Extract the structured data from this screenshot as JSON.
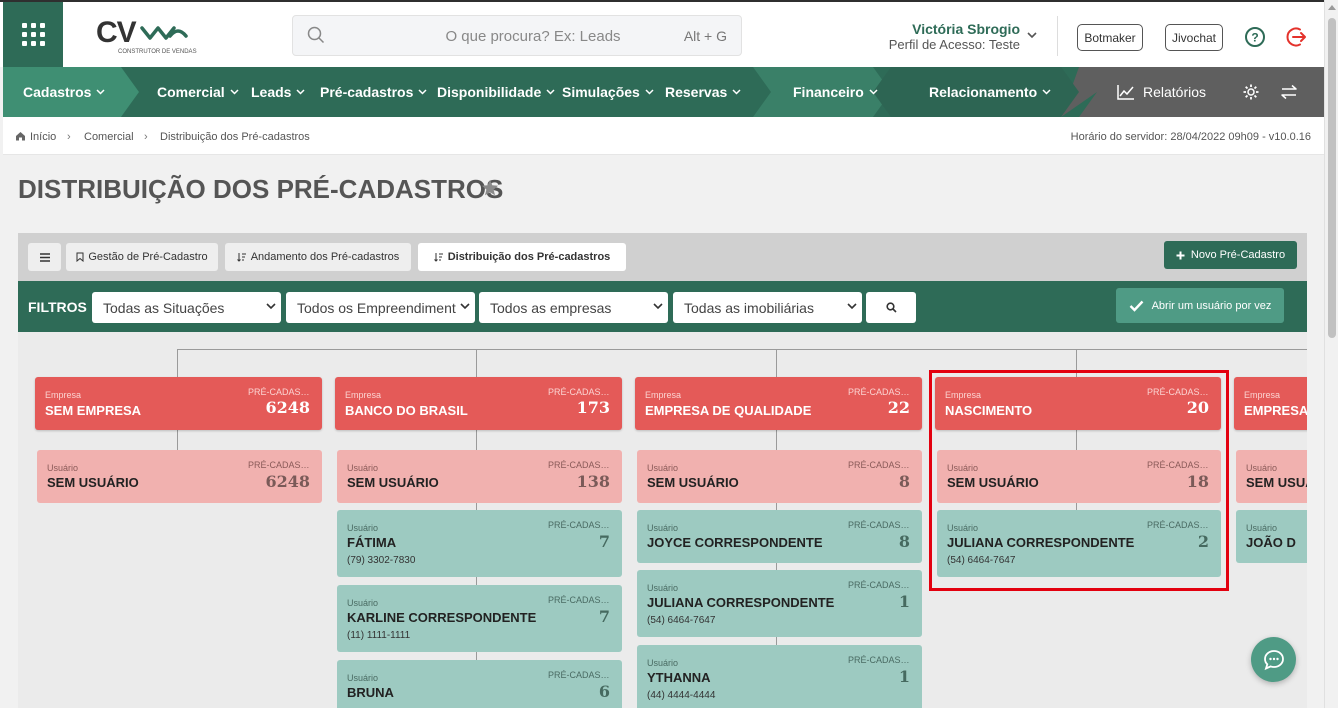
{
  "header": {
    "logo_text": "CV",
    "logo_subtitle": "CONSTRUTOR DE VENDAS",
    "search": {
      "placeholder": "O que procura? Ex: Leads",
      "shortcut": "Alt + G"
    },
    "user": {
      "name": "Victória Sbrogio",
      "profile": "Perfil de Acesso: Teste"
    },
    "buttons": [
      "Botmaker",
      "Jivochat"
    ]
  },
  "nav": {
    "items": [
      "Cadastros",
      "Comercial",
      "Leads",
      "Pré-cadastros",
      "Disponibilidade",
      "Simulações",
      "Reservas",
      "Financeiro",
      "Relacionamento"
    ],
    "reports": "Relatórios"
  },
  "breadcrumb": {
    "items": [
      "Início",
      "Comercial",
      "Distribuição dos Pré-cadastros"
    ],
    "server_time": "Horário do servidor: 28/04/2022 09h09 - v10.0.16"
  },
  "page": {
    "title": "DISTRIBUIÇÃO DOS PRÉ-CADASTROS"
  },
  "tabs": {
    "items": [
      "Gestão de Pré-Cadastro",
      "Andamento dos Pré-cadastros",
      "Distribuição dos Pré-cadastros"
    ],
    "new_button": "Novo Pré-Cadastro"
  },
  "filters": {
    "label": "FILTROS",
    "selects": [
      "Todas as Situações",
      "Todos os Empreendiment",
      "Todos as empresas",
      "Todas as imobiliárias"
    ],
    "one_user_button": "Abrir um usuário por vez"
  },
  "tree": {
    "company_label": "Empresa",
    "user_label": "Usuário",
    "company_count_label": "PRÉ-CADASTROS",
    "user_count_label": "PRÉ-CADASTROS",
    "columns": [
      {
        "company": "SEM EMPRESA",
        "count": "6248",
        "users": [
          {
            "name": "SEM USUÁRIO",
            "count": "6248",
            "phone": ""
          }
        ]
      },
      {
        "company": "BANCO DO BRASIL",
        "count": "173",
        "users": [
          {
            "name": "SEM USUÁRIO",
            "count": "138",
            "phone": ""
          },
          {
            "name": "FÁTIMA",
            "count": "7",
            "phone": "(79) 3302-7830"
          },
          {
            "name": "KARLINE CORRESPONDENTE",
            "count": "7",
            "phone": "(11) 1111-1111"
          },
          {
            "name": "BRUNA",
            "count": "6",
            "phone": ""
          }
        ]
      },
      {
        "company": "EMPRESA DE QUALIDADE",
        "count": "22",
        "users": [
          {
            "name": "SEM USUÁRIO",
            "count": "8",
            "phone": ""
          },
          {
            "name": "JOYCE CORRESPONDENTE",
            "count": "8",
            "phone": ""
          },
          {
            "name": "JULIANA CORRESPONDENTE",
            "count": "1",
            "phone": "(54) 6464-7647"
          },
          {
            "name": "YTHANNA",
            "count": "1",
            "phone": "(44) 4444-4444"
          }
        ]
      },
      {
        "company": "NASCIMENTO",
        "count": "20",
        "users": [
          {
            "name": "SEM USUÁRIO",
            "count": "18",
            "phone": ""
          },
          {
            "name": "JULIANA CORRESPONDENTE",
            "count": "2",
            "phone": "(54) 6464-7647"
          }
        ]
      },
      {
        "company": "EMPRESA",
        "count": "",
        "users": [
          {
            "name": "SEM USUÁRIO",
            "count": "",
            "phone": ""
          },
          {
            "name": "JOÃO D",
            "count": "",
            "phone": ""
          }
        ]
      }
    ]
  },
  "colors": {
    "primary": "#2e6b57",
    "company_card": "#e45a58",
    "no_user_card": "#f1b1af",
    "user_card": "#9dcac1",
    "highlight": "#e3000f"
  }
}
